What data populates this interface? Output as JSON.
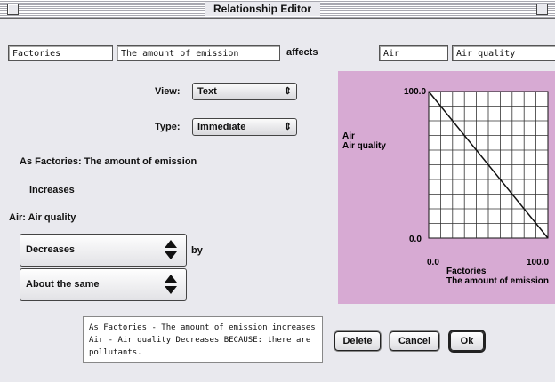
{
  "window": {
    "title": "Relationship Editor"
  },
  "header": {
    "source_object": "Factories",
    "source_property": "The amount of emission",
    "verb": "affects",
    "target_object": "Air",
    "target_property": "Air quality"
  },
  "view": {
    "label": "View:",
    "value": "Text"
  },
  "type": {
    "label": "Type:",
    "value": "Immediate"
  },
  "statement": {
    "line1": "As Factories: The amount of emission",
    "line2": "increases",
    "line3": "Air: Air quality"
  },
  "effect": {
    "direction": "Decreases",
    "by_label": "by",
    "magnitude": "About the same"
  },
  "description": "As Factories - The amount of emission increases Air - Air quality Decreases BECAUSE: there are pollutants.",
  "buttons": {
    "delete": "Delete",
    "cancel": "Cancel",
    "ok": "Ok"
  },
  "chart_data": {
    "type": "line",
    "ylabel": "Air\nAir quality",
    "xlabel": "Factories\nThe amount of emission",
    "x_ticks": [
      "0.0",
      "100.0"
    ],
    "y_ticks": [
      "0.0",
      "100.0"
    ],
    "xlim": [
      0,
      100
    ],
    "ylim": [
      0,
      100
    ],
    "grid": true,
    "series": [
      {
        "x": [
          0,
          100
        ],
        "y": [
          100,
          0
        ]
      }
    ]
  }
}
